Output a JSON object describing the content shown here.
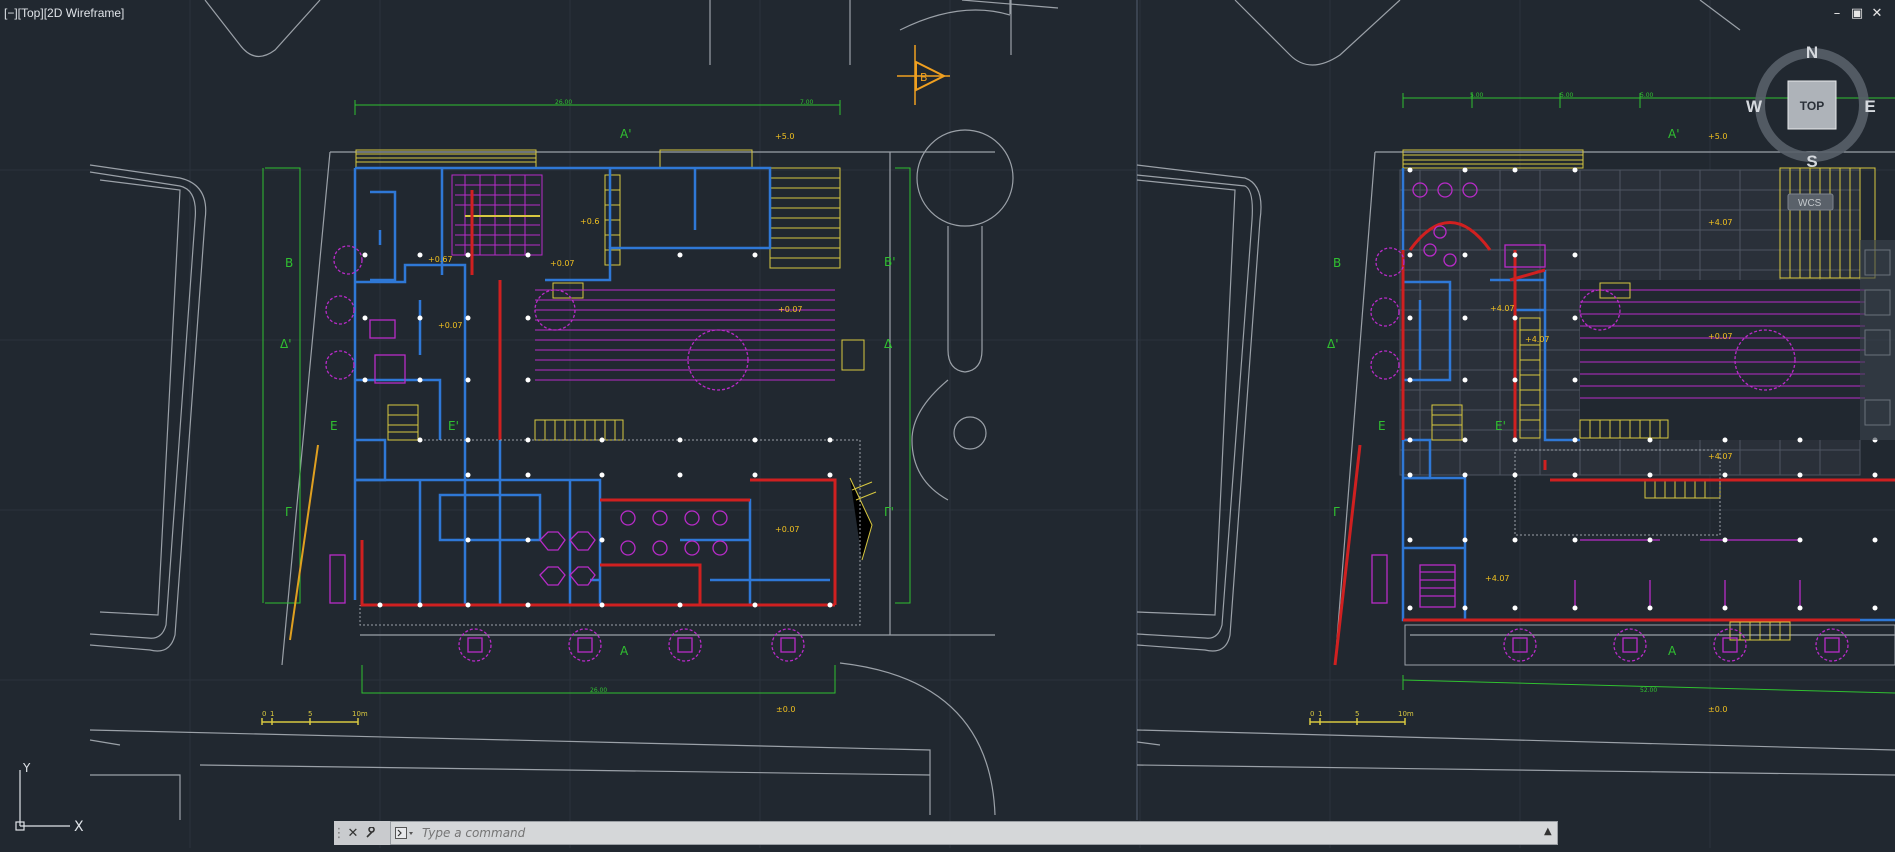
{
  "viewport": {
    "label": "[−][Top][2D Wireframe]",
    "window_controls": [
      "–",
      "▣",
      "✕"
    ]
  },
  "viewcube": {
    "north": "N",
    "south": "S",
    "east": "E",
    "west": "W",
    "face": "TOP",
    "wcs": "WCS"
  },
  "ucs": {
    "x": "X",
    "y": "Y"
  },
  "section_marker": "B",
  "left_plan": {
    "section_labels": [
      "B",
      "Δ'",
      "E",
      "Γ",
      "B'",
      "Δ",
      "E'",
      "Γ'",
      "A",
      "A'"
    ],
    "levels": [
      "+5.0",
      "±0.0",
      "+0.07",
      "+0.6",
      "+0.67",
      "+0.07",
      "+0.07",
      "+0.07"
    ],
    "scale": {
      "ticks": [
        "0",
        "1",
        "5",
        "10m"
      ]
    }
  },
  "right_plan": {
    "section_labels": [
      "B",
      "Δ'",
      "E",
      "Γ",
      "E'",
      "A'",
      "A"
    ],
    "levels": [
      "+5.0",
      "±0.0",
      "+4.07",
      "+4.07",
      "+0.07",
      "+4.07",
      "+4.07",
      "+4.07"
    ],
    "scale": {
      "ticks": [
        "0",
        "1",
        "5",
        "10m"
      ]
    }
  },
  "command_line": {
    "placeholder": "Type a command",
    "close_icon": "close-icon",
    "settings_icon": "wrench-icon",
    "prompt_icon": "command-prompt-icon"
  },
  "colors": {
    "background": "#212830",
    "wall_blue": "#2f78d6",
    "wall_red": "#d02020",
    "furniture_magenta": "#b82bc8",
    "dimension_green": "#30c030",
    "stairs_yellow": "#d8c840",
    "level_yellow": "#f0c020",
    "context_gray": "#9ba1a8"
  }
}
